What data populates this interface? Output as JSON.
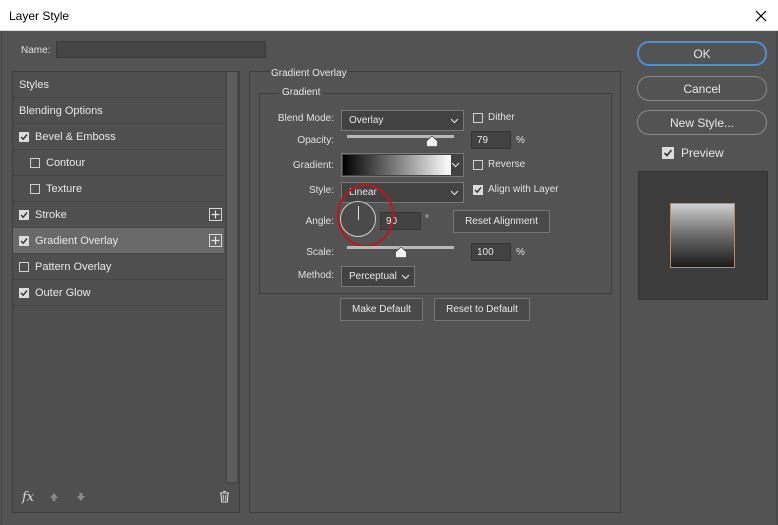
{
  "window": {
    "title": "Layer Style"
  },
  "name_field": {
    "label": "Name:",
    "value": ""
  },
  "styles_list": [
    {
      "label": "Styles",
      "checkbox": false,
      "checked": false,
      "sub": false,
      "selected": false,
      "plus": false
    },
    {
      "label": "Blending Options",
      "checkbox": false,
      "checked": false,
      "sub": false,
      "selected": false,
      "plus": false
    },
    {
      "label": "Bevel & Emboss",
      "checkbox": true,
      "checked": true,
      "sub": false,
      "selected": false,
      "plus": false
    },
    {
      "label": "Contour",
      "checkbox": true,
      "checked": false,
      "sub": true,
      "selected": false,
      "plus": false
    },
    {
      "label": "Texture",
      "checkbox": true,
      "checked": false,
      "sub": true,
      "selected": false,
      "plus": false
    },
    {
      "label": "Stroke",
      "checkbox": true,
      "checked": true,
      "sub": false,
      "selected": false,
      "plus": true
    },
    {
      "label": "Gradient Overlay",
      "checkbox": true,
      "checked": true,
      "sub": false,
      "selected": true,
      "plus": true
    },
    {
      "label": "Pattern Overlay",
      "checkbox": true,
      "checked": false,
      "sub": false,
      "selected": false,
      "plus": false
    },
    {
      "label": "Outer Glow",
      "checkbox": true,
      "checked": true,
      "sub": false,
      "selected": false,
      "plus": false
    }
  ],
  "panel": {
    "section_title": "Gradient Overlay",
    "group_title": "Gradient",
    "blend_mode": {
      "label": "Blend Mode:",
      "value": "Overlay"
    },
    "dither": {
      "label": "Dither",
      "checked": false
    },
    "opacity": {
      "label": "Opacity:",
      "value": "79",
      "unit": "%",
      "level": 0.79
    },
    "gradient": {
      "label": "Gradient:"
    },
    "reverse": {
      "label": "Reverse",
      "checked": false
    },
    "style": {
      "label": "Style:",
      "value": "Linear"
    },
    "align_with_layer": {
      "label": "Align with Layer",
      "checked": true
    },
    "angle": {
      "label": "Angle:",
      "value": "90",
      "unit": "°",
      "degrees": 90
    },
    "reset_alignment": "Reset Alignment",
    "scale": {
      "label": "Scale:",
      "value": "100",
      "unit": "%",
      "level": 0.5
    },
    "method": {
      "label": "Method:",
      "value": "Perceptual"
    },
    "make_default": "Make Default",
    "reset_to_default": "Reset to Default"
  },
  "buttons": {
    "ok": "OK",
    "cancel": "Cancel",
    "new_style": "New Style..."
  },
  "preview": {
    "label": "Preview",
    "checked": true
  },
  "colors": {
    "accent": "#4d8fd6",
    "highlight_ring": "#c0141c",
    "panel_bg": "#535353"
  }
}
